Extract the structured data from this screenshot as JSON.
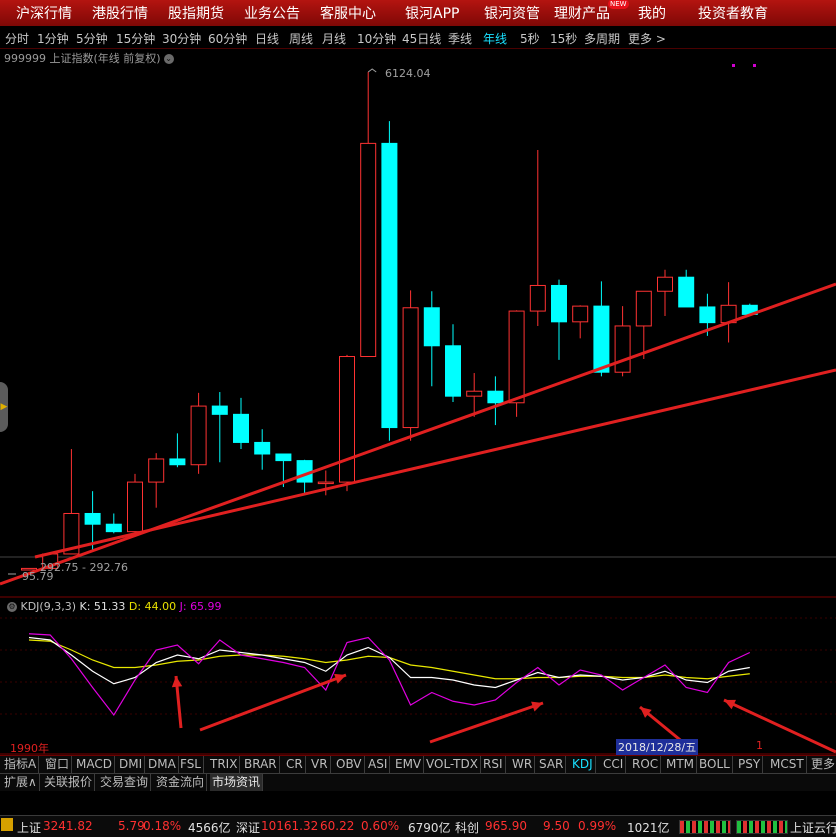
{
  "nav": {
    "items": [
      "沪深行情",
      "港股行情",
      "股指期货",
      "业务公告",
      "客服中心",
      "银河APP",
      "银河资管",
      "理财产品",
      "我的",
      "投资者教育"
    ],
    "badge": "NEW"
  },
  "periods": {
    "items": [
      "分时",
      "1分钟",
      "5分钟",
      "15分钟",
      "30分钟",
      "60分钟",
      "日线",
      "周线",
      "月线",
      "10分钟",
      "45日线",
      "季线",
      "年线",
      "5秒",
      "15秒",
      "多周期",
      "更多 >"
    ],
    "active": "年线"
  },
  "chart_title": "999999 上证指数(年线 前复权)",
  "chart_title_icon": "chevron-down-icon",
  "price_labels": {
    "high": "6124.04",
    "low": "95.79",
    "range": "292.75 - 292.76"
  },
  "chart_data": {
    "type": "candlestick",
    "symbol": "999999",
    "name": "上证指数",
    "period": "年线",
    "adjust": "前复权",
    "colors": {
      "up": "#ff3232",
      "down": "#00ffff"
    },
    "candles": [
      {
        "o": 96,
        "h": 120,
        "l": 96,
        "c": 115
      },
      {
        "o": 115,
        "h": 300,
        "l": 105,
        "c": 290
      },
      {
        "o": 290,
        "h": 1560,
        "l": 380,
        "c": 780
      },
      {
        "o": 780,
        "h": 1050,
        "l": 340,
        "c": 650
      },
      {
        "o": 650,
        "h": 780,
        "l": 540,
        "c": 560
      },
      {
        "o": 560,
        "h": 1260,
        "l": 520,
        "c": 1160
      },
      {
        "o": 1160,
        "h": 1510,
        "l": 850,
        "c": 1440
      },
      {
        "o": 1440,
        "h": 1750,
        "l": 1340,
        "c": 1370
      },
      {
        "o": 1370,
        "h": 2240,
        "l": 1260,
        "c": 2080
      },
      {
        "o": 2080,
        "h": 2250,
        "l": 1400,
        "c": 1980
      },
      {
        "o": 1980,
        "h": 2180,
        "l": 1560,
        "c": 1640
      },
      {
        "o": 1640,
        "h": 1800,
        "l": 1310,
        "c": 1500
      },
      {
        "o": 1500,
        "h": 1500,
        "l": 1100,
        "c": 1420
      },
      {
        "o": 1420,
        "h": 1430,
        "l": 1010,
        "c": 1160
      },
      {
        "o": 1160,
        "h": 1300,
        "l": 1000,
        "c": 1160
      },
      {
        "o": 1160,
        "h": 2700,
        "l": 1050,
        "c": 2680
      },
      {
        "o": 2680,
        "h": 6124,
        "l": 2680,
        "c": 5260
      },
      {
        "o": 5260,
        "h": 5530,
        "l": 1660,
        "c": 1820
      },
      {
        "o": 1820,
        "h": 3480,
        "l": 1660,
        "c": 3270
      },
      {
        "o": 3270,
        "h": 3470,
        "l": 2320,
        "c": 2810
      },
      {
        "o": 2810,
        "h": 3070,
        "l": 2130,
        "c": 2200
      },
      {
        "o": 2200,
        "h": 2480,
        "l": 1950,
        "c": 2260
      },
      {
        "o": 2260,
        "h": 2440,
        "l": 1850,
        "c": 2120
      },
      {
        "o": 2120,
        "h": 3240,
        "l": 1950,
        "c": 3230
      },
      {
        "o": 3230,
        "h": 5180,
        "l": 3050,
        "c": 3540
      },
      {
        "o": 3540,
        "h": 3610,
        "l": 2640,
        "c": 3100
      },
      {
        "o": 3100,
        "h": 3300,
        "l": 2900,
        "c": 3290
      },
      {
        "o": 3290,
        "h": 3590,
        "l": 2440,
        "c": 2490
      },
      {
        "o": 2490,
        "h": 3290,
        "l": 2440,
        "c": 3050
      },
      {
        "o": 3050,
        "h": 3460,
        "l": 2650,
        "c": 3470
      },
      {
        "o": 3470,
        "h": 3730,
        "l": 3170,
        "c": 3640
      },
      {
        "o": 3640,
        "h": 3730,
        "l": 3280,
        "c": 3280
      },
      {
        "o": 3280,
        "h": 3440,
        "l": 2930,
        "c": 3090
      },
      {
        "o": 3090,
        "h": 3580,
        "l": 2850,
        "c": 3300
      },
      {
        "o": 3300,
        "h": 3320,
        "l": 3170,
        "c": 3190
      }
    ],
    "indicator": {
      "name": "KDJ(9,3,3)",
      "K": "51.33",
      "D": "44.00",
      "J": "65.99",
      "colors": {
        "K": "#ffffff",
        "D": "#e8e800",
        "J": "#e000e0"
      }
    }
  },
  "bottom_left_label": "1990年",
  "cursor_date": "2018/12/28/五",
  "page_marker": "1",
  "indicator_tabs": {
    "items": [
      "指标A",
      "窗口",
      "MACD",
      "DMI",
      "DMA",
      "FSL",
      "TRIX",
      "BRAR",
      "CR",
      "VR",
      "OBV",
      "ASI",
      "EMV",
      "VOL-TDX",
      "RSI",
      "WR",
      "SAR",
      "KDJ",
      "CCI",
      "ROC",
      "MTM",
      "BOLL",
      "PSY",
      "MCST",
      "更多"
    ],
    "active": "KDJ"
  },
  "extra_tabs": {
    "items": [
      "扩展∧",
      "关联报价",
      "交易查询",
      "资金流向",
      "市场资讯"
    ],
    "active": "市场资讯"
  },
  "status_bar": {
    "sh_name": "上证",
    "sh_price": "3241.82",
    "sh_change": "5.79",
    "sh_pct": "0.18%",
    "sh_vol": "4566亿",
    "sz_name": "深证",
    "sz_price": "10161.32",
    "sz_change": "60.22",
    "sz_pct": "0.60%",
    "sz_vol": "6790亿",
    "kc_name": "科创",
    "kc_price": "965.90",
    "kc_change": "9.50",
    "kc_pct": "0.99%",
    "kc_vol": "1021亿",
    "cloud_label": "上证云行"
  }
}
